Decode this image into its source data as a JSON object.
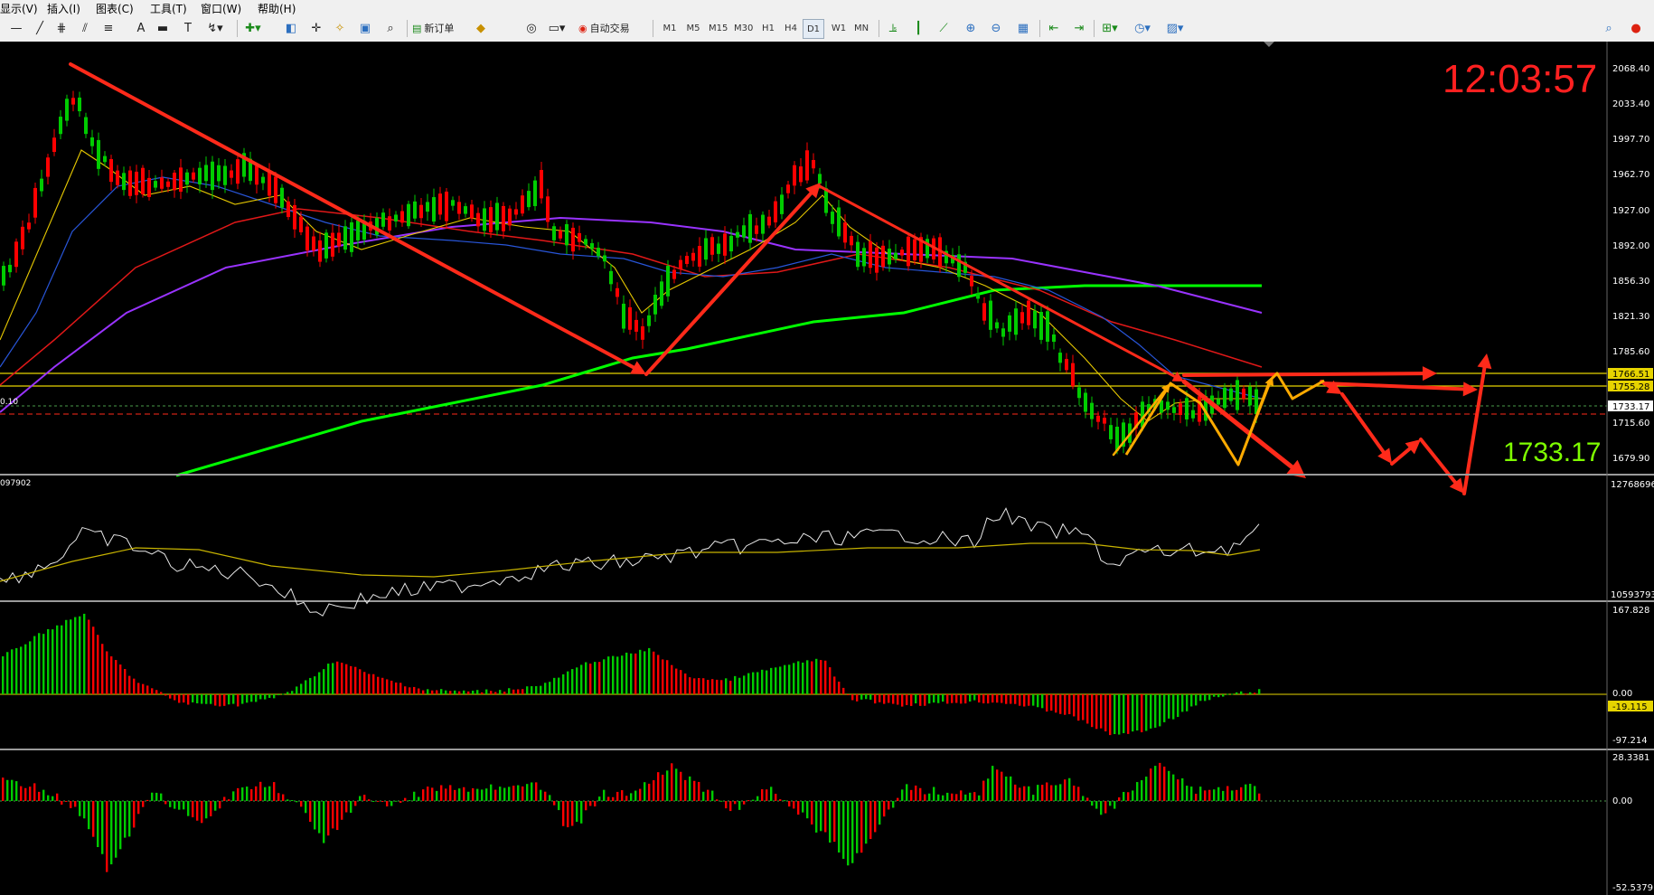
{
  "menu": {
    "view": "显示(V)",
    "insert": "插入(I)",
    "charts": "图表(C)",
    "tools": "工具(T)",
    "window": "窗口(W)",
    "help": "帮助(H)"
  },
  "toolbar": {
    "new_order": "新订单",
    "auto_trading": "自动交易",
    "timeframes": [
      "M1",
      "M5",
      "M15",
      "M30",
      "H1",
      "H4",
      "D1",
      "W1",
      "MN"
    ],
    "active_timeframe": "D1",
    "icons": [
      "minus-icon",
      "line-icon",
      "hashtag-icon",
      "text-icon",
      "label-icon",
      "text-box-icon",
      "arrows-icon",
      "new-chart-icon",
      "profiles-icon",
      "crosshair-icon",
      "market-watch-icon",
      "data-window-icon",
      "navigator-icon",
      "terminal-icon",
      "gold-icon",
      "metaeditor-icon",
      "strategy-tester-icon",
      "bar-chart-icon",
      "candle-chart-icon",
      "line-chart-icon",
      "zoom-in-icon",
      "zoom-out-icon",
      "tile-icon",
      "scroll-icon",
      "autoscroll-icon",
      "indicators-icon",
      "periods-icon",
      "templates-icon",
      "search-icon",
      "alert-icon"
    ]
  },
  "chart": {
    "clock": "12:03:57",
    "current_price": "1733.17",
    "price_axis": [
      "2068.40",
      "2033.40",
      "1997.70",
      "1962.70",
      "1927.00",
      "1892.00",
      "1856.30",
      "1821.30",
      "1785.60",
      "1715.60",
      "1679.90"
    ],
    "tagged_prices": {
      "level1": "1766.51",
      "level2": "1755.28",
      "current": "1733.17"
    },
    "left_label": "0.10",
    "colors": {
      "up": "#00cc00",
      "down": "#ff0000",
      "arrow": "#ff2a1a",
      "orange": "#ffaa00",
      "ma200": "#00ff00",
      "ma_purple": "#9933ff"
    }
  },
  "volume_panel": {
    "left_label": "097902",
    "top": "12768696",
    "bottom": "10593793"
  },
  "macd_panel": {
    "top": "167.828",
    "zero": "0.00",
    "signal": "-19.115",
    "bottom": "-97.214"
  },
  "osc_panel": {
    "top": "28.3381",
    "zero": "0.00",
    "bottom": "-52.5379"
  }
}
